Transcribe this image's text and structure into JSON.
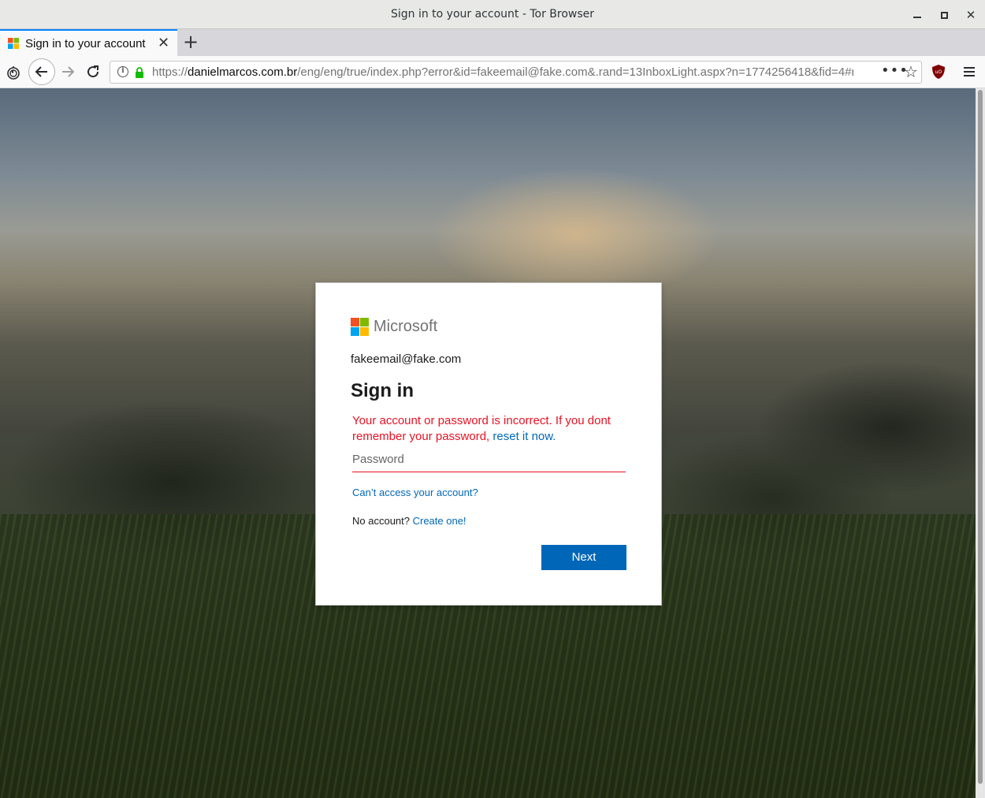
{
  "window": {
    "title": "Sign in to your account - Tor Browser"
  },
  "tabs": [
    {
      "label": "Sign in to your account",
      "active": true
    }
  ],
  "navbar": {
    "url_scheme": "https://",
    "url_host": "danielmarcos.com.br",
    "url_path": "/eng/eng/true/index.php?error&id=fakeemail@fake.com&.rand=13InboxLight.aspx?n=1774256418&fid=4#n=1..."
  },
  "signin": {
    "brand": "Microsoft",
    "email": "fakeemail@fake.com",
    "heading": "Sign in",
    "error_text": "Your account or password is incorrect. If you dont remember your password, ",
    "error_link": "reset it now.",
    "password_placeholder": "Password",
    "cant_access": "Can’t access your account?",
    "no_account": "No account? ",
    "create_link": "Create one!",
    "next_label": "Next"
  },
  "colors": {
    "ms_red": "#f25022",
    "ms_green": "#7fba00",
    "ms_blue": "#00a4ef",
    "ms_yellow": "#ffb900",
    "link": "#0067b8",
    "error": "#e81123"
  },
  "icons": {
    "back": "arrow-left-icon",
    "forward": "arrow-right-icon",
    "reload": "reload-icon",
    "menu": "hamburger-icon"
  }
}
